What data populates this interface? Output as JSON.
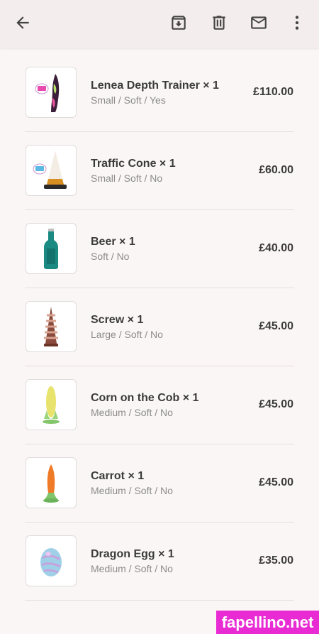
{
  "appbar": {
    "back_icon": "arrow-back-icon",
    "archive_icon": "archive-icon",
    "delete_icon": "trash-icon",
    "mail_icon": "mail-icon",
    "more_icon": "more-vertical-icon"
  },
  "items": [
    {
      "name": "Lenea Depth Trainer × 1",
      "variant": "Small / Soft / Yes",
      "price": "£110.00"
    },
    {
      "name": "Traffic Cone × 1",
      "variant": "Small / Soft / No",
      "price": "£60.00"
    },
    {
      "name": "Beer × 1",
      "variant": "Soft / No",
      "price": "£40.00"
    },
    {
      "name": "Screw × 1",
      "variant": "Large / Soft / No",
      "price": "£45.00"
    },
    {
      "name": "Corn on the Cob × 1",
      "variant": "Medium / Soft / No",
      "price": "£45.00"
    },
    {
      "name": "Carrot × 1",
      "variant": "Medium / Soft / No",
      "price": "£45.00"
    },
    {
      "name": "Dragon Egg × 1",
      "variant": "Medium / Soft / No",
      "price": "£35.00"
    }
  ],
  "watermark": "fapellino.net"
}
